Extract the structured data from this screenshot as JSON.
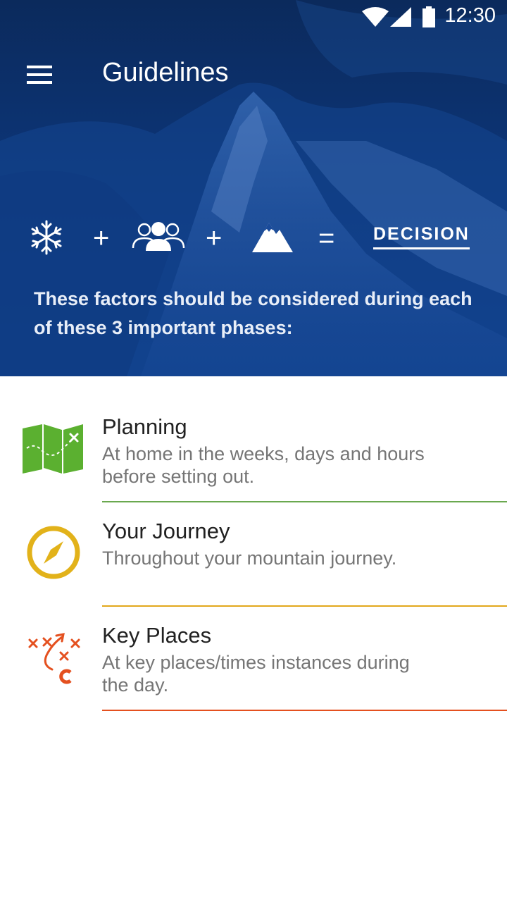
{
  "status_bar": {
    "time": "12:30",
    "icons": [
      "wifi-icon",
      "signal-icon",
      "battery-icon"
    ]
  },
  "header": {
    "menu_icon": "hamburger-menu-icon",
    "title": "Guidelines"
  },
  "equation": {
    "factors": [
      "snowflake-icon",
      "group-people-icon",
      "mountain-icon"
    ],
    "plus": "+",
    "equals": "=",
    "result": "DECISION"
  },
  "hero_text": "These factors should be considered during each of these 3 important phases:",
  "phases": [
    {
      "icon": "map-icon",
      "title": "Planning",
      "description": "At home in the weeks, days and hours before setting out.",
      "color": "#6aa84f"
    },
    {
      "icon": "compass-icon",
      "title": "Your Journey",
      "description": "Throughout your mountain journey.",
      "color": "#e2a81c"
    },
    {
      "icon": "strategy-plan-icon",
      "title": "Key Places",
      "description": "At key places/times instances during the day.",
      "color": "#e4501f"
    }
  ],
  "colors": {
    "hero_blue": "#0d3577",
    "planning_green": "#5bb030",
    "journey_yellow": "#e2b21a",
    "keyplaces_red": "#e4501f"
  }
}
